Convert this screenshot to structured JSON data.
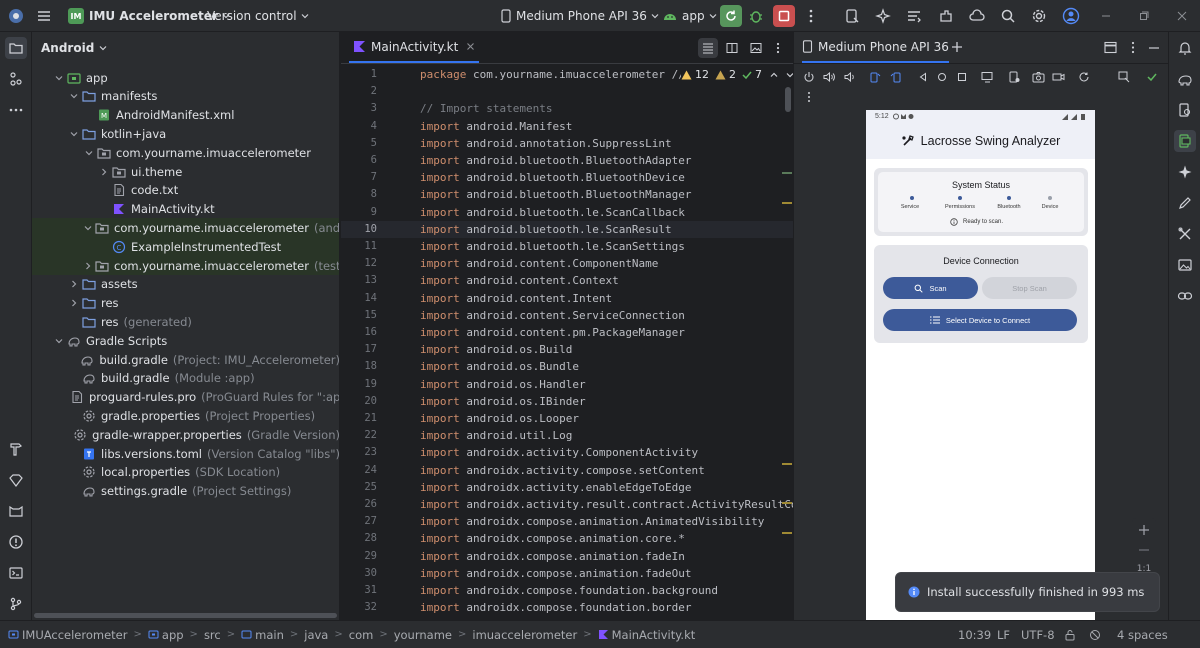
{
  "titlebar": {
    "project_badge": "IM",
    "project_name": "IMU Accelerometer",
    "vcs": "Version control",
    "device": "Medium Phone API 36",
    "run_config": "app"
  },
  "project_panel": {
    "view_mode": "Android",
    "tree": [
      {
        "label": "app",
        "extra": "",
        "icon": "module-folder-icon"
      },
      {
        "label": "manifests",
        "extra": "",
        "icon": "folder-icon"
      },
      {
        "label": "AndroidManifest.xml",
        "extra": "",
        "icon": "manifest-file-icon"
      },
      {
        "label": "kotlin+java",
        "extra": "",
        "icon": "folder-icon"
      },
      {
        "label": "com.yourname.imuaccelerometer",
        "extra": "",
        "icon": "package-icon"
      },
      {
        "label": "ui.theme",
        "extra": "",
        "icon": "package-icon"
      },
      {
        "label": "code.txt",
        "extra": "",
        "icon": "text-file-icon"
      },
      {
        "label": "MainActivity.kt",
        "extra": "",
        "icon": "kotlin-file-icon"
      },
      {
        "label": "com.yourname.imuaccelerometer",
        "extra": "(androidTest)",
        "icon": "package-icon"
      },
      {
        "label": "ExampleInstrumentedTest",
        "extra": "",
        "icon": "test-class-icon"
      },
      {
        "label": "com.yourname.imuaccelerometer",
        "extra": "(test)",
        "icon": "package-icon"
      },
      {
        "label": "assets",
        "extra": "",
        "icon": "folder-icon"
      },
      {
        "label": "res",
        "extra": "",
        "icon": "folder-icon"
      },
      {
        "label": "res",
        "extra": "(generated)",
        "icon": "folder-icon"
      },
      {
        "label": "Gradle Scripts",
        "extra": "",
        "icon": "gradle-icon"
      },
      {
        "label": "build.gradle",
        "extra": "(Project: IMU_Accelerometer)",
        "icon": "gradle-file-icon"
      },
      {
        "label": "build.gradle",
        "extra": "(Module :app)",
        "icon": "gradle-file-icon"
      },
      {
        "label": "proguard-rules.pro",
        "extra": "(ProGuard Rules for \":app\")",
        "icon": "text-file-icon"
      },
      {
        "label": "gradle.properties",
        "extra": "(Project Properties)",
        "icon": "settings-file-icon"
      },
      {
        "label": "gradle-wrapper.properties",
        "extra": "(Gradle Version)",
        "icon": "settings-file-icon"
      },
      {
        "label": "libs.versions.toml",
        "extra": "(Version Catalog \"libs\")",
        "icon": "toml-file-icon"
      },
      {
        "label": "local.properties",
        "extra": "(SDK Location)",
        "icon": "settings-file-icon"
      },
      {
        "label": "settings.gradle",
        "extra": "(Project Settings)",
        "icon": "gradle-file-icon"
      }
    ]
  },
  "editor": {
    "tab_label": "MainActivity.kt",
    "inspections": {
      "warnings": "12",
      "weak_warnings": "2",
      "typos": "7"
    },
    "current_line": 10,
    "lines": [
      {
        "n": "1",
        "kw": "package",
        "rest": " com.yourname.imuaccelerometer //"
      },
      {
        "n": "2",
        "kw": "",
        "rest": ""
      },
      {
        "n": "3",
        "kw": "",
        "rest": "// Import statements"
      },
      {
        "n": "4",
        "kw": "import",
        "rest": " android.Manifest"
      },
      {
        "n": "5",
        "kw": "import",
        "rest": " android.annotation.SuppressLint"
      },
      {
        "n": "6",
        "kw": "import",
        "rest": " android.bluetooth.BluetoothAdapter"
      },
      {
        "n": "7",
        "kw": "import",
        "rest": " android.bluetooth.BluetoothDevice"
      },
      {
        "n": "8",
        "kw": "import",
        "rest": " android.bluetooth.BluetoothManager"
      },
      {
        "n": "9",
        "kw": "import",
        "rest": " android.bluetooth.le.ScanCallback"
      },
      {
        "n": "10",
        "kw": "import",
        "rest": " android.bluetooth.le.ScanResult"
      },
      {
        "n": "11",
        "kw": "import",
        "rest": " android.bluetooth.le.ScanSettings"
      },
      {
        "n": "12",
        "kw": "import",
        "rest": " android.content.ComponentName"
      },
      {
        "n": "13",
        "kw": "import",
        "rest": " android.content.Context"
      },
      {
        "n": "14",
        "kw": "import",
        "rest": " android.content.Intent"
      },
      {
        "n": "15",
        "kw": "import",
        "rest": " android.content.ServiceConnection"
      },
      {
        "n": "16",
        "kw": "import",
        "rest": " android.content.pm.PackageManager"
      },
      {
        "n": "17",
        "kw": "import",
        "rest": " android.os.Build"
      },
      {
        "n": "18",
        "kw": "import",
        "rest": " android.os.Bundle"
      },
      {
        "n": "19",
        "kw": "import",
        "rest": " android.os.Handler"
      },
      {
        "n": "20",
        "kw": "import",
        "rest": " android.os.IBinder"
      },
      {
        "n": "21",
        "kw": "import",
        "rest": " android.os.Looper"
      },
      {
        "n": "22",
        "kw": "import",
        "rest": " android.util.Log"
      },
      {
        "n": "23",
        "kw": "import",
        "rest": " androidx.activity.ComponentActivity"
      },
      {
        "n": "24",
        "kw": "import",
        "rest": " androidx.activity.compose.setContent"
      },
      {
        "n": "25",
        "kw": "import",
        "rest": " androidx.activity.enableEdgeToEdge"
      },
      {
        "n": "26",
        "kw": "import",
        "rest": " androidx.activity.result.contract.ActivityResultCont"
      },
      {
        "n": "27",
        "kw": "import",
        "rest": " androidx.compose.animation.AnimatedVisibility"
      },
      {
        "n": "28",
        "kw": "import",
        "rest": " androidx.compose.animation.core.*"
      },
      {
        "n": "29",
        "kw": "import",
        "rest": " androidx.compose.animation.fadeIn"
      },
      {
        "n": "30",
        "kw": "import",
        "rest": " androidx.compose.animation.fadeOut"
      },
      {
        "n": "31",
        "kw": "import",
        "rest": " androidx.compose.foundation.background"
      },
      {
        "n": "32",
        "kw": "import",
        "rest": " androidx.compose.foundation.border"
      }
    ]
  },
  "device_panel": {
    "tab_label": "Medium Phone API 36",
    "zoom_label": "1:1"
  },
  "phone": {
    "time": "5:12",
    "app_title": "Lacrosse Swing Analyzer",
    "system_status": {
      "title": "System Status",
      "items": [
        "Service",
        "Permissions",
        "Bluetooth",
        "Device"
      ],
      "message": "Ready to scan."
    },
    "device_connection": {
      "title": "Device Connection",
      "scan": "Scan",
      "stop_scan": "Stop Scan",
      "select": "Select Device to Connect"
    }
  },
  "toast": {
    "message": "Install successfully finished in 993 ms"
  },
  "statusbar": {
    "breadcrumbs": [
      "IMUAccelerometer",
      "app",
      "src",
      "main",
      "java",
      "com",
      "yourname",
      "imuaccelerometer",
      "MainActivity.kt"
    ],
    "position": "10:39",
    "line_sep": "LF",
    "encoding": "UTF-8",
    "indent": "4 spaces"
  },
  "colors": {
    "accent": "#3574f0",
    "run_green": "#57965c",
    "stop_red": "#c94f4f",
    "app_button": "#3d5a99",
    "keyword": "#cf8e6d",
    "annotation": "#b3ae60"
  }
}
